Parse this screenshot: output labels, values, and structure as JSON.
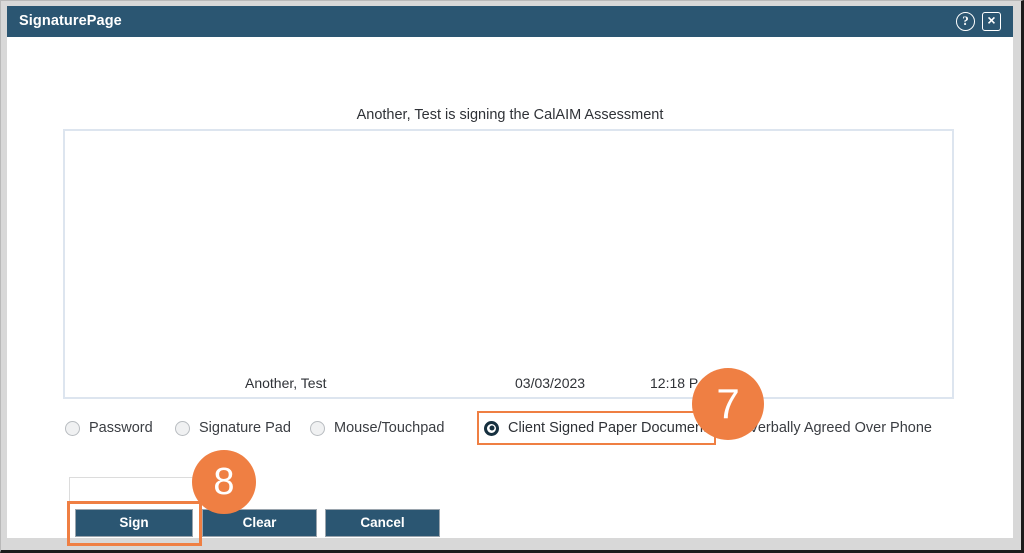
{
  "window": {
    "title": "SignaturePage",
    "help_icon": "help-circle-icon",
    "close_icon": "close-icon",
    "help_glyph": "?",
    "close_glyph": "×"
  },
  "dialog": {
    "signing_statement": "Another, Test is signing the CalAIM Assessment"
  },
  "signature_canvas": {
    "name": "Another, Test",
    "date": "03/03/2023",
    "time": "12:18 P"
  },
  "signature_methods": {
    "options": [
      {
        "id": "password",
        "label": "Password",
        "selected": false
      },
      {
        "id": "signature-pad",
        "label": "Signature Pad",
        "selected": false
      },
      {
        "id": "mouse-touchpad",
        "label": "Mouse/Touchpad",
        "selected": false
      },
      {
        "id": "client-signed-paper",
        "label": "Client Signed Paper Document",
        "selected": true
      },
      {
        "id": "verbally-agreed",
        "label": "Verbally Agreed Over Phone",
        "selected": false
      }
    ]
  },
  "password_field": {
    "value": "",
    "placeholder": ""
  },
  "actions": {
    "sign_label": "Sign",
    "clear_label": "Clear",
    "cancel_label": "Cancel"
  },
  "annotations": {
    "badge_seven": "7",
    "badge_eight": "8"
  },
  "colors": {
    "title_bar": "#2b5672",
    "button_navy": "#2b5672",
    "accent_orange": "#ef7f43",
    "canvas_border": "#dde5ef",
    "frame_gray": "#d8d8d8"
  }
}
